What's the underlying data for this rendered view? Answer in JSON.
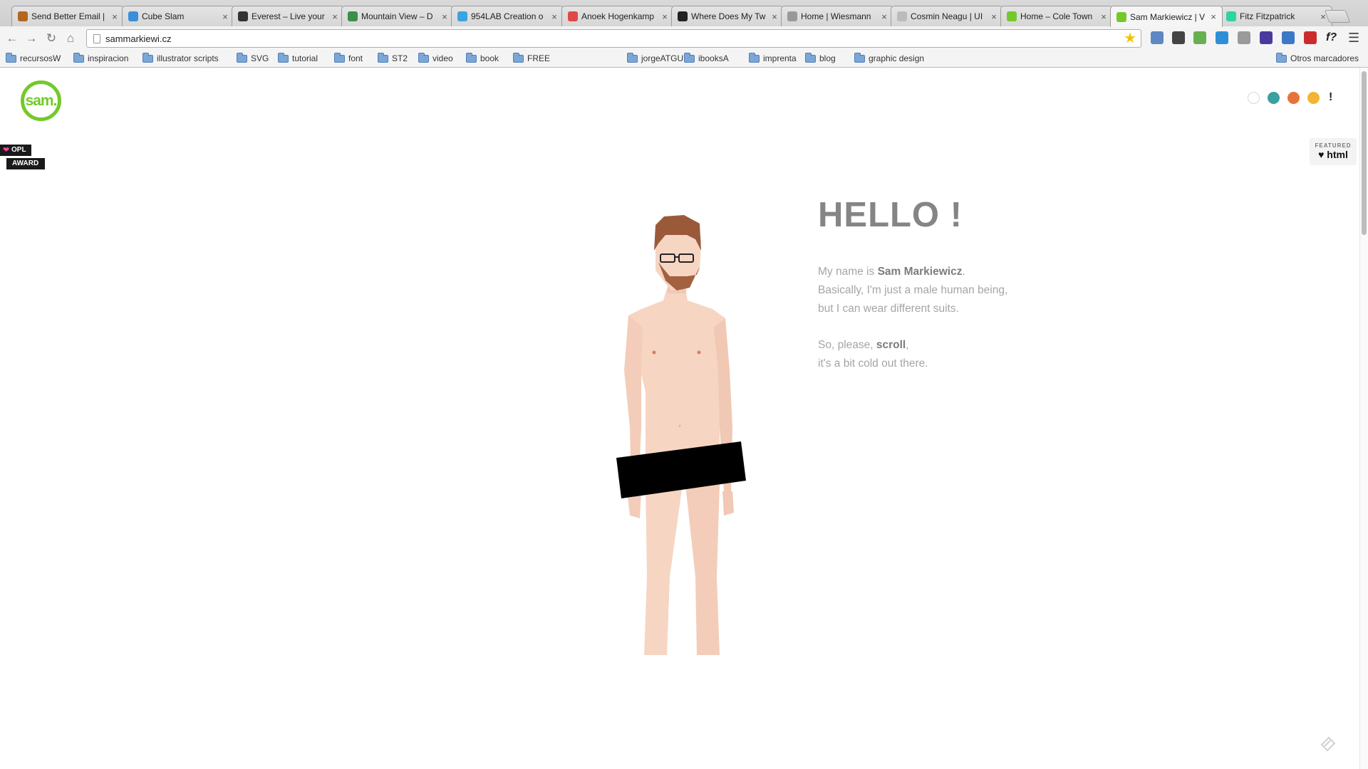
{
  "tabs": [
    {
      "title": "Send Better Email |",
      "color": "#b5651d"
    },
    {
      "title": "Cube Slam",
      "color": "#3b8ed8"
    },
    {
      "title": "Everest – Live your",
      "color": "#333333"
    },
    {
      "title": "Mountain View – D",
      "color": "#3a8f4b"
    },
    {
      "title": "954LAB Creation o",
      "color": "#3aa3e0"
    },
    {
      "title": "Anoek Hogenkamp",
      "color": "#e04848"
    },
    {
      "title": "Where Does My Tw",
      "color": "#222222"
    },
    {
      "title": "Home | Wiesmann",
      "color": "#999999"
    },
    {
      "title": "Cosmin Neagu | UI",
      "color": "#bbbbbb"
    },
    {
      "title": "Home – Cole Town",
      "color": "#73c92a"
    },
    {
      "title": "Sam Markiewicz | V",
      "color": "#73c92a"
    },
    {
      "title": "Fitz Fitzpatrick",
      "color": "#2ed3a3"
    }
  ],
  "address": {
    "url": "sammarkiewi.cz"
  },
  "bookmarks": [
    "recursosW",
    "inspiracion",
    "illustrator scripts",
    "SVG",
    "tutorial",
    "font",
    "ST2",
    "video",
    "book",
    "FREE",
    "jorgeATGU",
    "ibooksA",
    "imprenta",
    "blog",
    "graphic design"
  ],
  "other_bookmarks": "Otros marcadores",
  "page": {
    "logo": "sam.",
    "theme_dots": [
      "#ffffff",
      "#3aa0a0",
      "#e8733a",
      "#f2b533"
    ],
    "bang": "!",
    "opl_badge": "OPL",
    "award_badge": "AWARD",
    "featured_label": "FEATURED",
    "featured_brand": "♥ html",
    "hello": "HELLO !",
    "intro": {
      "line1_pre": "My name is ",
      "name": "Sam Markiewicz",
      "line1_post": ".",
      "line2": "Basically, I'm just a male human being,",
      "line3": "but I can wear different suits.",
      "line4_pre": "So, please, ",
      "scroll": "scroll",
      "line4_post": ",",
      "line5": "it's a bit cold out there."
    }
  },
  "colors": {
    "brand": "#73c92a",
    "skin": "#f6d5c3",
    "hair": "#9a5a3a"
  }
}
